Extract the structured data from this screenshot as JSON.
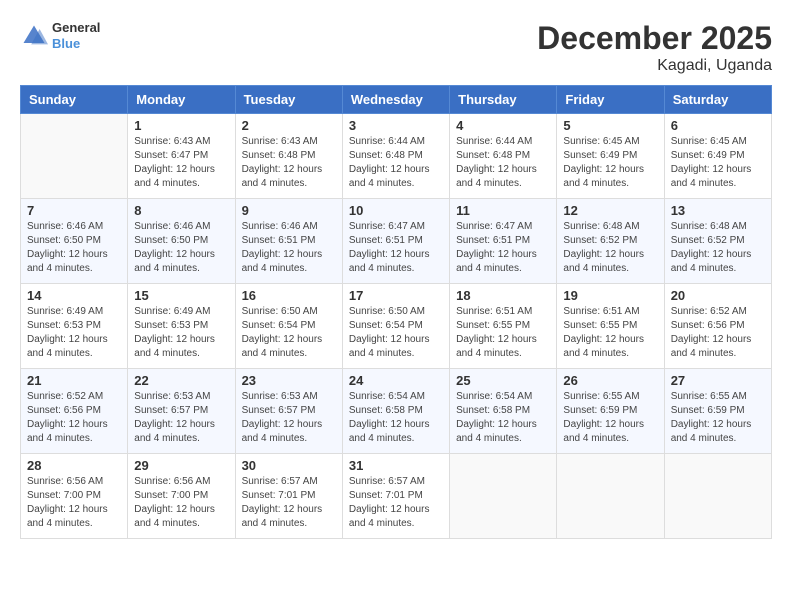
{
  "header": {
    "logo_line1": "General",
    "logo_line2": "Blue",
    "title": "December 2025",
    "subtitle": "Kagadi, Uganda"
  },
  "days_of_week": [
    "Sunday",
    "Monday",
    "Tuesday",
    "Wednesday",
    "Thursday",
    "Friday",
    "Saturday"
  ],
  "weeks": [
    [
      {
        "day": "",
        "info": ""
      },
      {
        "day": "1",
        "info": "Sunrise: 6:43 AM\nSunset: 6:47 PM\nDaylight: 12 hours\nand 4 minutes."
      },
      {
        "day": "2",
        "info": "Sunrise: 6:43 AM\nSunset: 6:48 PM\nDaylight: 12 hours\nand 4 minutes."
      },
      {
        "day": "3",
        "info": "Sunrise: 6:44 AM\nSunset: 6:48 PM\nDaylight: 12 hours\nand 4 minutes."
      },
      {
        "day": "4",
        "info": "Sunrise: 6:44 AM\nSunset: 6:48 PM\nDaylight: 12 hours\nand 4 minutes."
      },
      {
        "day": "5",
        "info": "Sunrise: 6:45 AM\nSunset: 6:49 PM\nDaylight: 12 hours\nand 4 minutes."
      },
      {
        "day": "6",
        "info": "Sunrise: 6:45 AM\nSunset: 6:49 PM\nDaylight: 12 hours\nand 4 minutes."
      }
    ],
    [
      {
        "day": "7",
        "info": "Sunrise: 6:46 AM\nSunset: 6:50 PM\nDaylight: 12 hours\nand 4 minutes."
      },
      {
        "day": "8",
        "info": "Sunrise: 6:46 AM\nSunset: 6:50 PM\nDaylight: 12 hours\nand 4 minutes."
      },
      {
        "day": "9",
        "info": "Sunrise: 6:46 AM\nSunset: 6:51 PM\nDaylight: 12 hours\nand 4 minutes."
      },
      {
        "day": "10",
        "info": "Sunrise: 6:47 AM\nSunset: 6:51 PM\nDaylight: 12 hours\nand 4 minutes."
      },
      {
        "day": "11",
        "info": "Sunrise: 6:47 AM\nSunset: 6:51 PM\nDaylight: 12 hours\nand 4 minutes."
      },
      {
        "day": "12",
        "info": "Sunrise: 6:48 AM\nSunset: 6:52 PM\nDaylight: 12 hours\nand 4 minutes."
      },
      {
        "day": "13",
        "info": "Sunrise: 6:48 AM\nSunset: 6:52 PM\nDaylight: 12 hours\nand 4 minutes."
      }
    ],
    [
      {
        "day": "14",
        "info": "Sunrise: 6:49 AM\nSunset: 6:53 PM\nDaylight: 12 hours\nand 4 minutes."
      },
      {
        "day": "15",
        "info": "Sunrise: 6:49 AM\nSunset: 6:53 PM\nDaylight: 12 hours\nand 4 minutes."
      },
      {
        "day": "16",
        "info": "Sunrise: 6:50 AM\nSunset: 6:54 PM\nDaylight: 12 hours\nand 4 minutes."
      },
      {
        "day": "17",
        "info": "Sunrise: 6:50 AM\nSunset: 6:54 PM\nDaylight: 12 hours\nand 4 minutes."
      },
      {
        "day": "18",
        "info": "Sunrise: 6:51 AM\nSunset: 6:55 PM\nDaylight: 12 hours\nand 4 minutes."
      },
      {
        "day": "19",
        "info": "Sunrise: 6:51 AM\nSunset: 6:55 PM\nDaylight: 12 hours\nand 4 minutes."
      },
      {
        "day": "20",
        "info": "Sunrise: 6:52 AM\nSunset: 6:56 PM\nDaylight: 12 hours\nand 4 minutes."
      }
    ],
    [
      {
        "day": "21",
        "info": "Sunrise: 6:52 AM\nSunset: 6:56 PM\nDaylight: 12 hours\nand 4 minutes."
      },
      {
        "day": "22",
        "info": "Sunrise: 6:53 AM\nSunset: 6:57 PM\nDaylight: 12 hours\nand 4 minutes."
      },
      {
        "day": "23",
        "info": "Sunrise: 6:53 AM\nSunset: 6:57 PM\nDaylight: 12 hours\nand 4 minutes."
      },
      {
        "day": "24",
        "info": "Sunrise: 6:54 AM\nSunset: 6:58 PM\nDaylight: 12 hours\nand 4 minutes."
      },
      {
        "day": "25",
        "info": "Sunrise: 6:54 AM\nSunset: 6:58 PM\nDaylight: 12 hours\nand 4 minutes."
      },
      {
        "day": "26",
        "info": "Sunrise: 6:55 AM\nSunset: 6:59 PM\nDaylight: 12 hours\nand 4 minutes."
      },
      {
        "day": "27",
        "info": "Sunrise: 6:55 AM\nSunset: 6:59 PM\nDaylight: 12 hours\nand 4 minutes."
      }
    ],
    [
      {
        "day": "28",
        "info": "Sunrise: 6:56 AM\nSunset: 7:00 PM\nDaylight: 12 hours\nand 4 minutes."
      },
      {
        "day": "29",
        "info": "Sunrise: 6:56 AM\nSunset: 7:00 PM\nDaylight: 12 hours\nand 4 minutes."
      },
      {
        "day": "30",
        "info": "Sunrise: 6:57 AM\nSunset: 7:01 PM\nDaylight: 12 hours\nand 4 minutes."
      },
      {
        "day": "31",
        "info": "Sunrise: 6:57 AM\nSunset: 7:01 PM\nDaylight: 12 hours\nand 4 minutes."
      },
      {
        "day": "",
        "info": ""
      },
      {
        "day": "",
        "info": ""
      },
      {
        "day": "",
        "info": ""
      }
    ]
  ]
}
